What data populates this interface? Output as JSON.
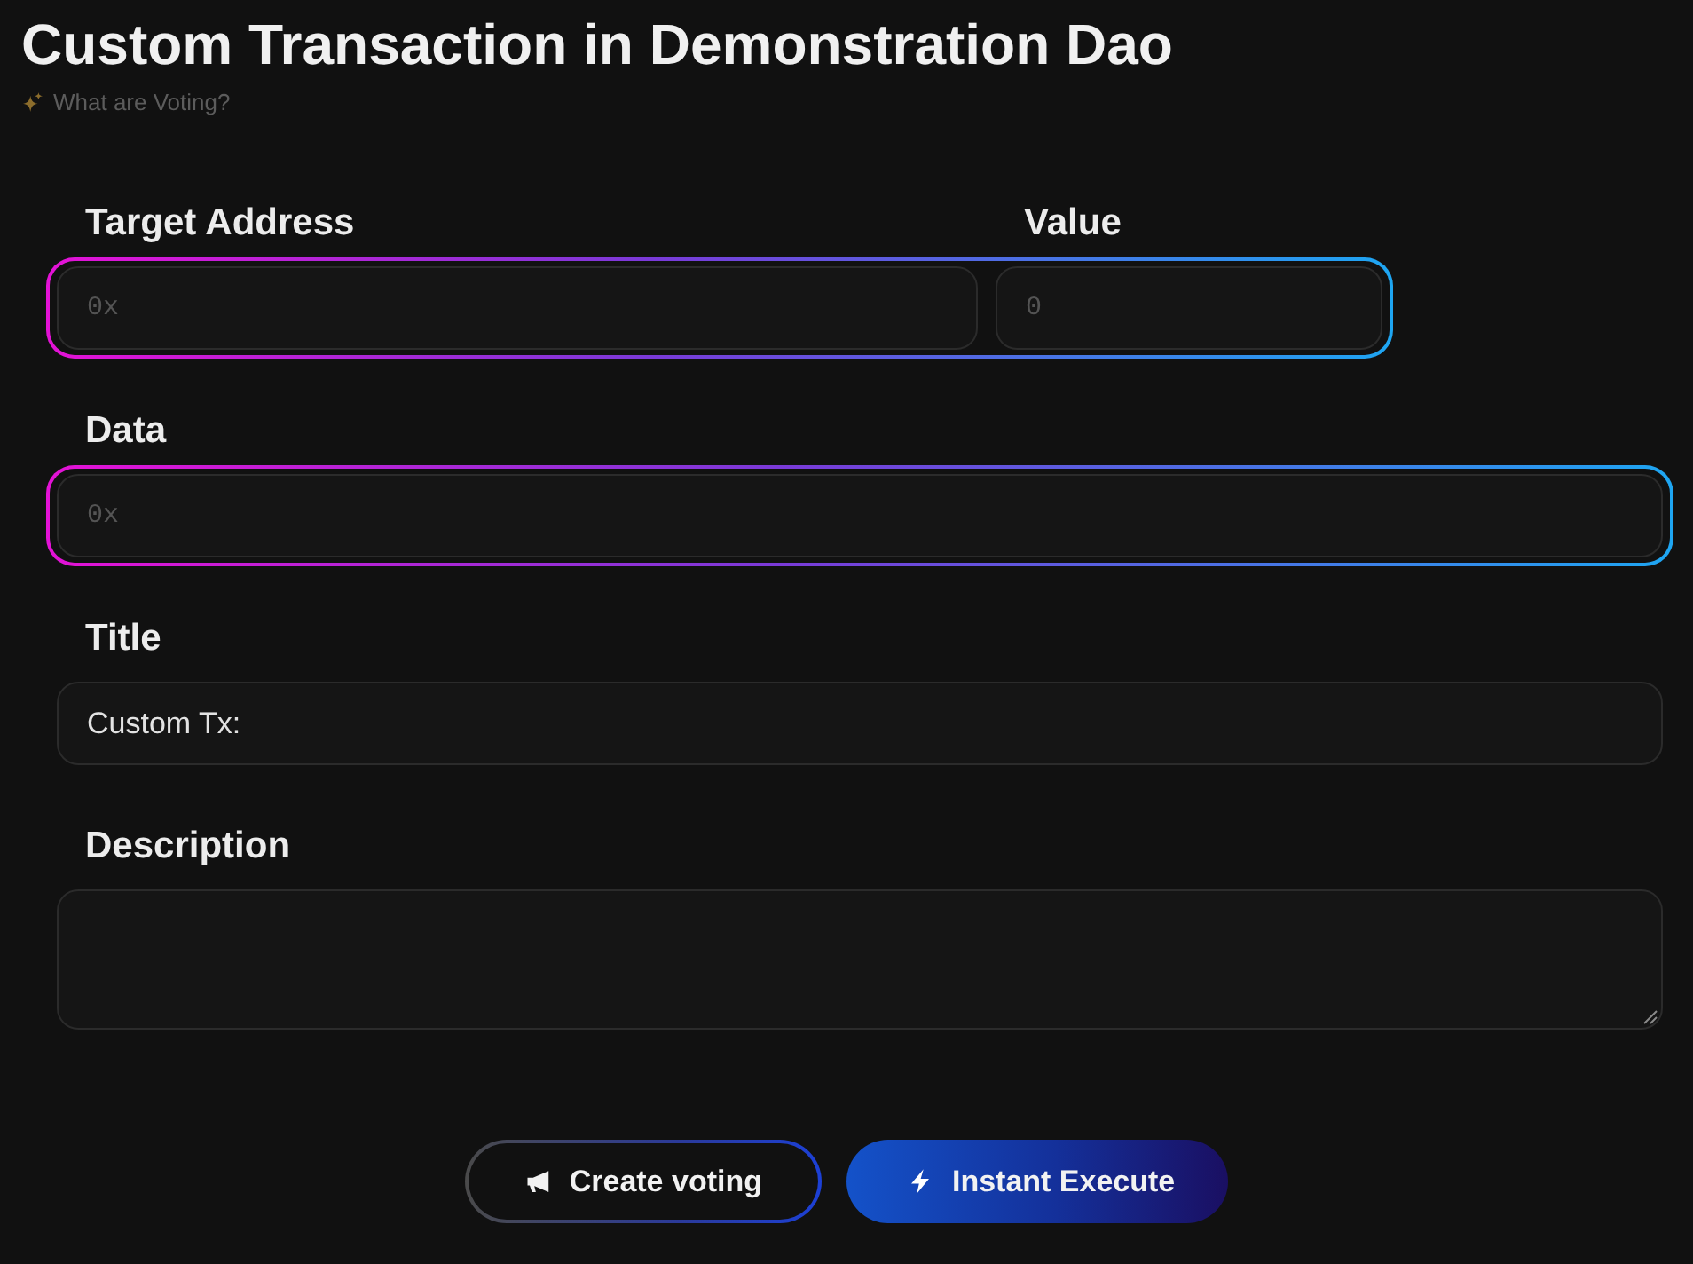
{
  "header": {
    "title": "Custom Transaction in Demonstration Dao",
    "help_link": "What are Voting?"
  },
  "rows": [
    {
      "highlighted": true,
      "fields": [
        {
          "kind": "code",
          "label": "Target Address",
          "placeholder": "0x"
        },
        {
          "kind": "code",
          "label": "Value",
          "placeholder": "0"
        }
      ]
    },
    {
      "highlighted": true,
      "fields": [
        {
          "kind": "code",
          "label": "Data",
          "placeholder": "0x"
        }
      ]
    },
    {
      "highlighted": false,
      "fields": [
        {
          "kind": "text",
          "label": "Title",
          "value": "Custom Tx:"
        }
      ]
    },
    {
      "highlighted": false,
      "fields": [
        {
          "kind": "multiline",
          "label": "Description"
        }
      ]
    }
  ],
  "actions": [
    {
      "kind": "secondary",
      "label": "Create voting"
    },
    {
      "kind": "primary",
      "label": "Instant Execute"
    }
  ]
}
